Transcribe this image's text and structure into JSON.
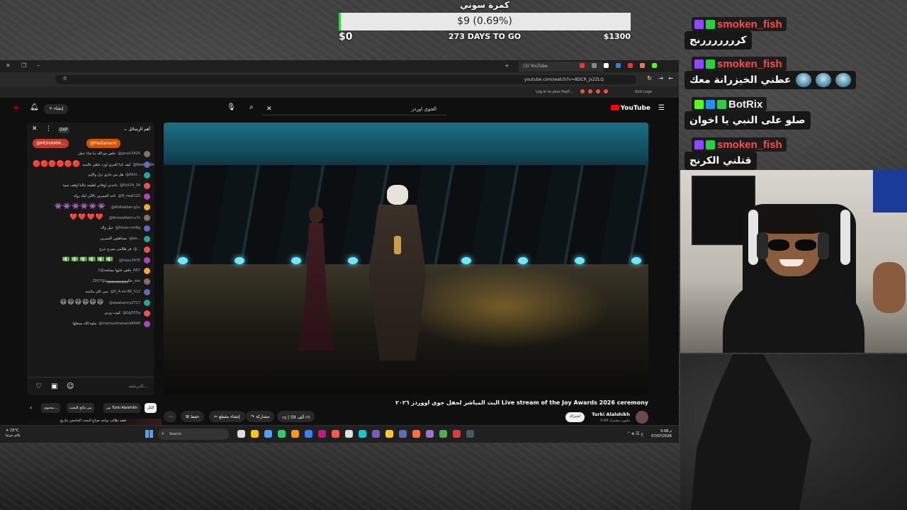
{
  "goal": {
    "title": "كمرة سوني",
    "amount_label": "$9 (0.69%)",
    "progress": 0.0069,
    "start": "$0",
    "days_left": "273 DAYS TO GO",
    "target": "$1300"
  },
  "browser": {
    "tab_title": "(3) YouTube",
    "url": "youtube.com/watch?v=8DCR_jx2ZLQ",
    "bookmark_text": "Log in to your PayP...",
    "bookmark_kick": "Kick Logo"
  },
  "youtube": {
    "logo_text": "YouTube",
    "search_query": "الجوي اوردز",
    "create_label": "إنشاء",
    "avatar_initial": "ت"
  },
  "chat": {
    "header_title": "أهم الرسائل",
    "xp_label": "0XP",
    "pins": [
      "@MOHAMM...",
      "@Pestanorni"
    ],
    "messages": [
      {
        "name": "@jana13425",
        "text": "خلص مو الله ما شاء عمل"
      },
      {
        "name": "@Reem-k9m3h",
        "text": "كيف كذا الجري اوزد ماهي غاليتيه"
      },
      {
        "name": "@Akhr...",
        "text": "هل مي جاري تزل والإيم"
      },
      {
        "name": "@FsX34_34",
        "text": "تاخذني اوقاتي لطيفة تتالنا اوقف سوء"
      },
      {
        "name": "@N_naal123",
        "text": "تاخذ السيرين بالالي ليلة رواه"
      },
      {
        "name": "@AliAlakber-g1u",
        "text": ""
      },
      {
        "name": "@AmoodAsiri-u7s",
        "text": ""
      },
      {
        "name": "@htoon-mi4lg",
        "text": "حيل واك"
      },
      {
        "name": "@aa...",
        "text": "يستاهلون السيرين"
      },
      {
        "name": "@...",
        "text": "قر ظالمي بسرح عرج"
      },
      {
        "name": "@hayu3476",
        "text": ""
      },
      {
        "name": "@2_AR7",
        "text": "خلص خليها مسلحة"
      },
      {
        "name": "@2007_sox",
        "text": "خالهههههههههههههه"
      },
      {
        "name": "@S_A-oa-88_S12",
        "text": "مين بالي ماشيه"
      },
      {
        "name": "@alaakamry2717",
        "text": ""
      },
      {
        "name": "@Gg555g",
        "text": "كيوت وربي"
      },
      {
        "name": "@maroualmanane8448",
        "text": "ملوة الله يسعلها"
      }
    ],
    "input_placeholder": "الدردشة..."
  },
  "video": {
    "title": "البث المباشر لحفل جوي اووردز ٢٠٢٦ Live stream of the Joy Awards 2026 ceremony",
    "channel": "Turki Alalshikh",
    "subscribers": "3.64 مليون مشترك",
    "subscribe": "اشتراك",
    "likes": "59 ألف",
    "share": "مشاركة",
    "clip": "إنشاء مقطع",
    "save": "حفظ",
    "filters": [
      "الكل",
      "من Turki Alalshikh",
      "من نتائج البحث",
      "محتوى..."
    ],
    "rec_title": "قصة طالب يواجه ضياع البحث الجامعي بتاريخ"
  },
  "taskbar": {
    "temp": "23°C",
    "weather": "غائم جزئيا",
    "search": "Search",
    "time": "5:08 م",
    "date": "07/07/2026",
    "app_colors": [
      "#ddd",
      "#f5c518",
      "#4aa3ff",
      "#2ecc71",
      "#ff9900",
      "#3b82f6",
      "#c71585",
      "#ff5555",
      "#e0e0e0",
      "#14c9c9",
      "#7e57c2",
      "#ffca28",
      "#5c6bc0",
      "#ff7043",
      "#9575cd",
      "#4caf50",
      "#e53935",
      "#455a64"
    ]
  },
  "stream_chat": [
    {
      "user": "smoken_fish",
      "user_color": "#ff4d4d",
      "badges": [
        "#9146ff",
        "#2ecc40"
      ],
      "text": "كرررررررنج",
      "emotes": 0
    },
    {
      "user": "smoken_fish",
      "user_color": "#ff4d4d",
      "badges": [
        "#9146ff",
        "#2ecc40"
      ],
      "text": "عطني الخيزرانة معك",
      "emotes": 3
    },
    {
      "user": "BotRix",
      "user_color": "#eeeeee",
      "badges": [
        "#53fc18",
        "#1e90ff",
        "#2ecc40"
      ],
      "text": "صلو على النبي يا اخوان",
      "emotes": 0
    },
    {
      "user": "smoken_fish",
      "user_color": "#ff4d4d",
      "badges": [
        "#9146ff",
        "#2ecc40"
      ],
      "text": "قتلني الكرنج",
      "emotes": 0
    }
  ]
}
